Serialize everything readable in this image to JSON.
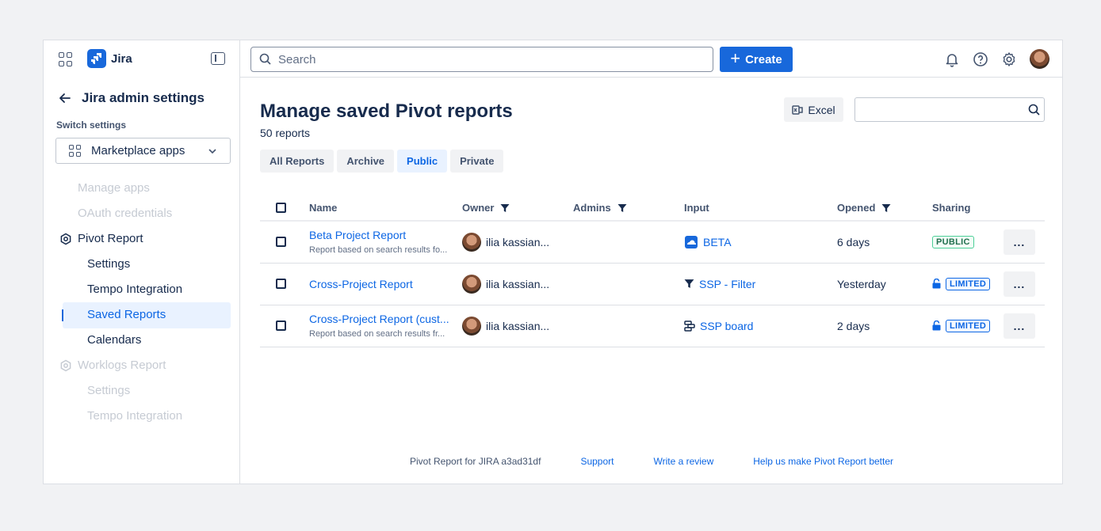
{
  "app": {
    "name": "Jira"
  },
  "sidebar": {
    "back_title": "Jira admin settings",
    "switch_label": "Switch settings",
    "switch_value": "Marketplace apps",
    "items": [
      {
        "label": "Manage apps"
      },
      {
        "label": "OAuth credentials"
      },
      {
        "label": "Pivot Report"
      },
      {
        "label": "Settings"
      },
      {
        "label": "Tempo Integration"
      },
      {
        "label": "Saved Reports"
      },
      {
        "label": "Calendars"
      },
      {
        "label": "Worklogs Report"
      },
      {
        "label": "Settings"
      },
      {
        "label": "Tempo Integration"
      }
    ]
  },
  "topbar": {
    "search_placeholder": "Search",
    "create_label": "Create"
  },
  "main": {
    "title": "Manage saved Pivot reports",
    "count": "50 reports",
    "excel_label": "Excel",
    "tabs": [
      {
        "label": "All Reports"
      },
      {
        "label": "Archive"
      },
      {
        "label": "Public"
      },
      {
        "label": "Private"
      }
    ],
    "columns": {
      "name": "Name",
      "owner": "Owner",
      "admins": "Admins",
      "input": "Input",
      "opened": "Opened",
      "sharing": "Sharing"
    },
    "rows": [
      {
        "name": "Beta Project Report",
        "sub": "Report based on search results fo...",
        "owner": "ilia kassian...",
        "input": "BETA",
        "opened": "6 days",
        "sharing": "PUBLIC"
      },
      {
        "name": "Cross-Project Report",
        "sub": "",
        "owner": "ilia kassian...",
        "input": "SSP - Filter",
        "opened": "Yesterday",
        "sharing": "LIMITED"
      },
      {
        "name": "Cross-Project Report (cust...",
        "sub": "Report based on search results fr...",
        "owner": "ilia kassian...",
        "input": "SSP board",
        "opened": "2 days",
        "sharing": "LIMITED"
      }
    ],
    "more_label": "..."
  },
  "footer": {
    "version": "Pivot Report for JIRA a3ad31df",
    "support": "Support",
    "review": "Write a review",
    "help": "Help us make Pivot Report better"
  },
  "colors": {
    "accent": "#1868db",
    "link": "#0c66e4",
    "public": "#216e4e"
  }
}
